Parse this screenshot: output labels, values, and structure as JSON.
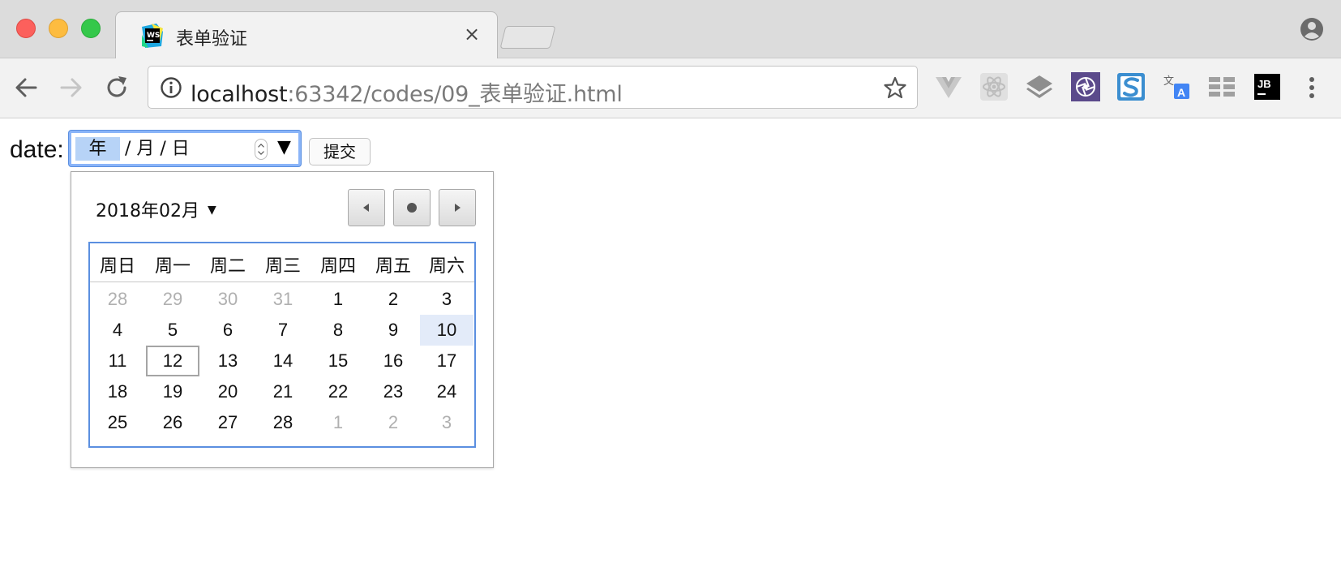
{
  "tab": {
    "title": "表单验证",
    "close": "×"
  },
  "toolbar": {
    "url_host": "localhost",
    "url_path": ":63342/codes/09_表单验证.html",
    "extensions": [
      "vue-devtools-icon",
      "react-devtools-icon",
      "layers-icon",
      "aperture-icon",
      "s-extension-icon",
      "translate-icon",
      "grid-icon",
      "jetbrains-icon"
    ]
  },
  "form": {
    "label": "date:",
    "year_placeholder": "年",
    "rest_placeholder": "/ 月 / 日",
    "dropdown": "▼",
    "submit": "提交"
  },
  "calendar": {
    "month_label": "2018年02月",
    "caret": "▼",
    "weekdays": [
      "周日",
      "周一",
      "周二",
      "周三",
      "周四",
      "周五",
      "周六"
    ],
    "weeks": [
      [
        "28",
        "29",
        "30",
        "31",
        "1",
        "2",
        "3"
      ],
      [
        "4",
        "5",
        "6",
        "7",
        "8",
        "9",
        "10"
      ],
      [
        "11",
        "12",
        "13",
        "14",
        "15",
        "16",
        "17"
      ],
      [
        "18",
        "19",
        "20",
        "21",
        "22",
        "23",
        "24"
      ],
      [
        "25",
        "26",
        "27",
        "28",
        "1",
        "2",
        "3"
      ]
    ],
    "muted_cells": [
      [
        0,
        0
      ],
      [
        0,
        1
      ],
      [
        0,
        2
      ],
      [
        0,
        3
      ],
      [
        4,
        4
      ],
      [
        4,
        5
      ],
      [
        4,
        6
      ]
    ],
    "selected_cell": [
      1,
      6
    ],
    "today_cell": [
      2,
      1
    ]
  }
}
